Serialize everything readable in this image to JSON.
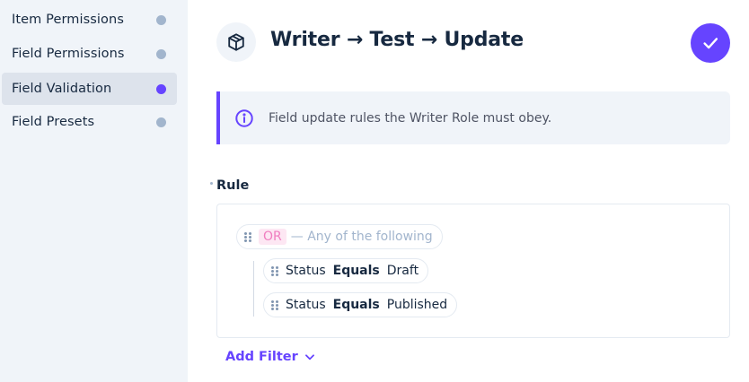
{
  "sidebar": {
    "items": [
      {
        "label": "Item Permissions",
        "active": false
      },
      {
        "label": "Field Permissions",
        "active": false
      },
      {
        "label": "Field Validation",
        "active": true
      },
      {
        "label": "Field Presets",
        "active": false
      }
    ]
  },
  "header": {
    "title": "Writer → Test → Update",
    "icon": "box-icon",
    "save_icon": "check-icon"
  },
  "notice": {
    "icon": "info-icon",
    "text": "Field update rules the Writer Role must obey."
  },
  "rule": {
    "label": "Rule",
    "group": {
      "logic": "OR",
      "description": "— Any of the following"
    },
    "conditions": [
      {
        "field": "Status",
        "operator": "Equals",
        "value": "Draft"
      },
      {
        "field": "Status",
        "operator": "Equals",
        "value": "Published"
      }
    ],
    "add_filter_label": "Add Filter"
  },
  "colors": {
    "accent": "#6644ff",
    "sidebar_bg": "#f0f4f9",
    "or_badge_bg": "#fde7f3",
    "or_badge_text": "#f07ec0"
  }
}
